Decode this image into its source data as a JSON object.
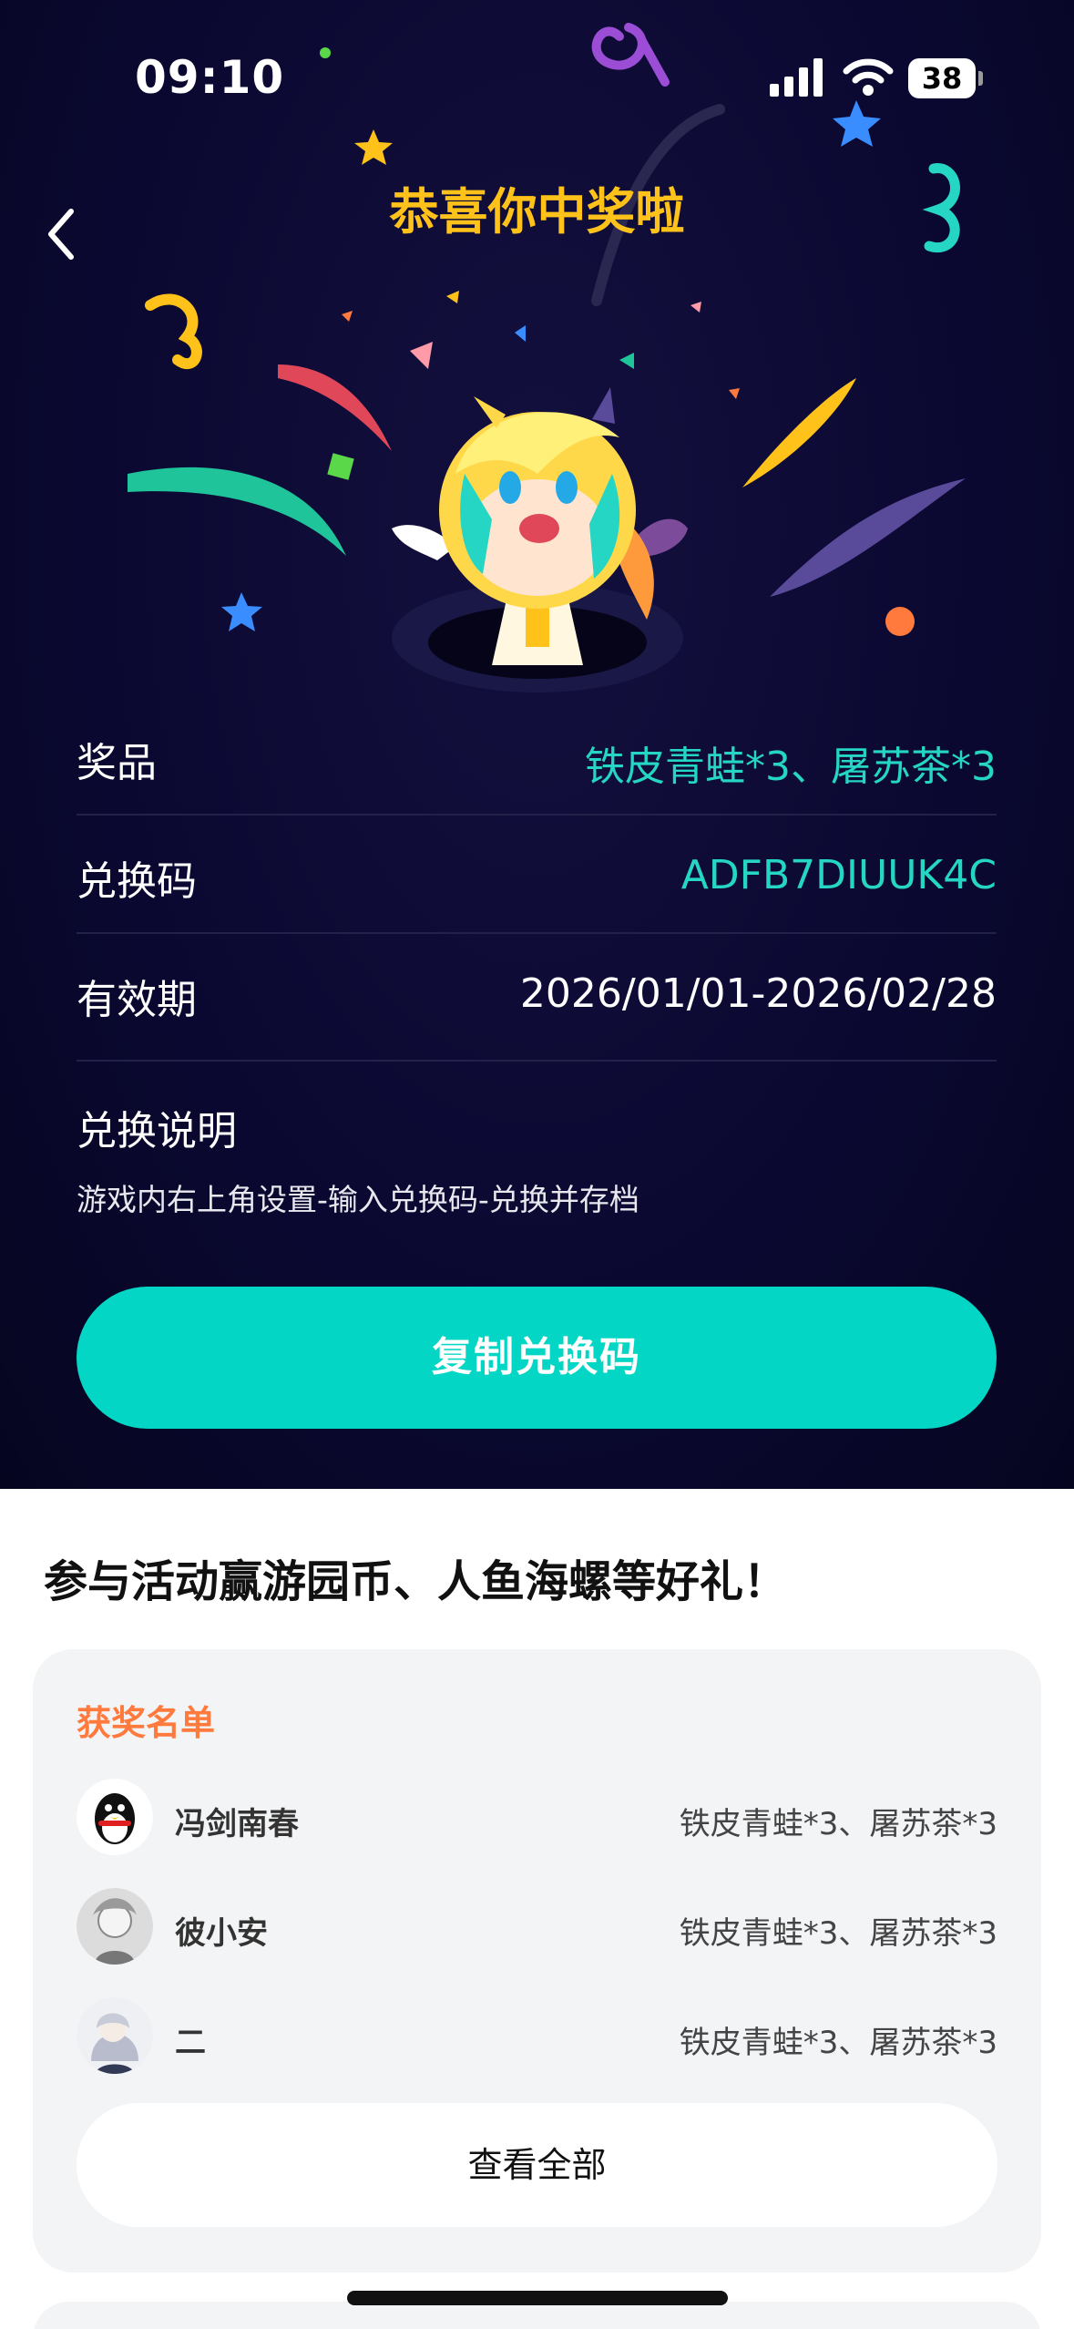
{
  "status_bar": {
    "time": "09:10",
    "battery": "38"
  },
  "header": {
    "title": "恭喜你中奖啦"
  },
  "prize_info": {
    "rows": [
      {
        "label": "奖品",
        "value": "铁皮青蛙*3、屠苏茶*3"
      },
      {
        "label": "兑换码",
        "value": "ADFB7DIUUK4C"
      },
      {
        "label": "有效期",
        "value": "2026/01/01-2026/02/28"
      }
    ],
    "explain_title": "兑换说明",
    "explain_text": "游戏内右上角设置-输入兑换码-兑换并存档",
    "copy_button": "复制兑换码"
  },
  "colors": {
    "accent_teal": "#03d6c4",
    "title_gold": "#ffc21a",
    "winner_title": "#ff7a3c",
    "bg_dark": "#0a0830"
  },
  "promo": {
    "title": "参与活动赢游园币、人鱼海螺等好礼！"
  },
  "winners": {
    "title": "获奖名单",
    "list": [
      {
        "name": "冯剑南春",
        "prize": "铁皮青蛙*3、屠苏茶*3",
        "avatar_icon": "qq-penguin-avatar"
      },
      {
        "name": "彼小安",
        "prize": "铁皮青蛙*3、屠苏茶*3",
        "avatar_icon": "anime-sketch-avatar"
      },
      {
        "name": "二",
        "prize": "铁皮青蛙*3、屠苏茶*3",
        "avatar_icon": "anime-girl-avatar"
      }
    ],
    "view_all": "查看全部"
  }
}
